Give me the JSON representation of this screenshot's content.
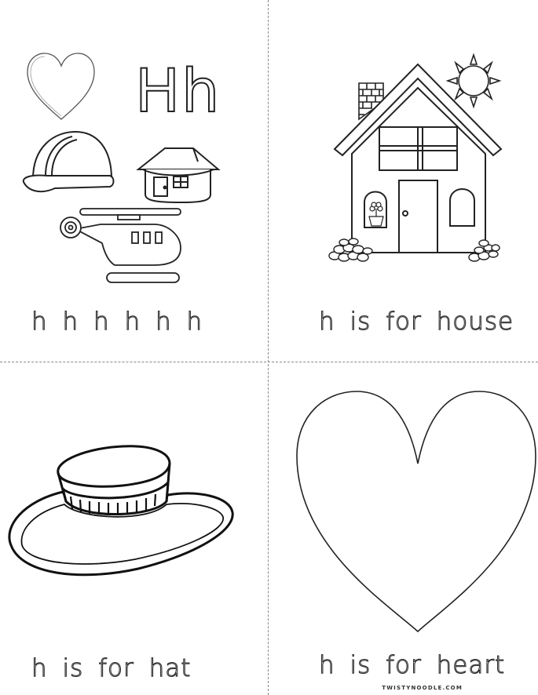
{
  "panels": {
    "top_left": {
      "big_letter": "Hh",
      "trace_text": "h h h h h h"
    },
    "top_right": {
      "sentence": "h is for house"
    },
    "bottom_left": {
      "sentence": "h is for hat"
    },
    "bottom_right": {
      "sentence": "h is for heart"
    }
  },
  "footer": {
    "credit": "TWISTYNOODLE.COM"
  },
  "icons": {
    "top_left": [
      "heart-icon",
      "helmet-icon",
      "house-icon",
      "helicopter-icon"
    ],
    "top_right": [
      "house-icon",
      "sun-icon",
      "chimney-icon",
      "flower-pot-icon"
    ],
    "bottom_left": [
      "hat-icon"
    ],
    "bottom_right": [
      "heart-icon"
    ]
  },
  "colors": {
    "line": "#222222",
    "cut_line": "#8a8a8a"
  }
}
